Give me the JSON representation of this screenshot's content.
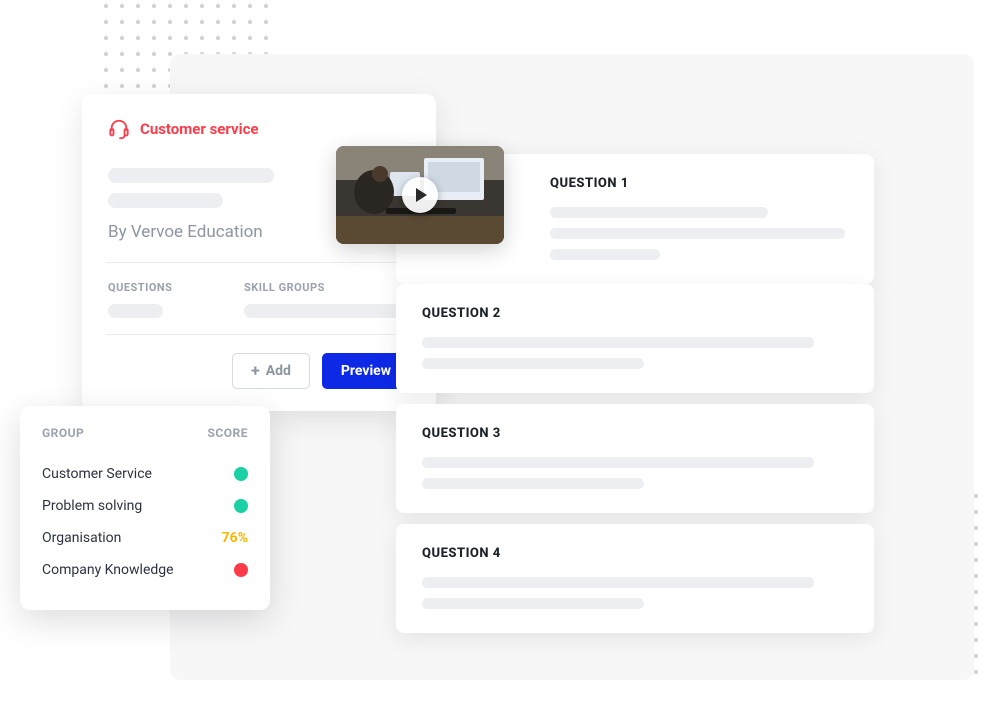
{
  "leftCard": {
    "title": "Customer service",
    "byline": "By Vervoe Education",
    "meta": {
      "questionsLabel": "QUESTIONS",
      "skillGroupsLabel": "SKILL GROUPS"
    },
    "actions": {
      "addLabel": "Add",
      "previewLabel": "Preview"
    }
  },
  "questions": {
    "q1": "QUESTION 1",
    "q2": "QUESTION 2",
    "q3": "QUESTION 3",
    "q4": "QUESTION 4"
  },
  "scoreCard": {
    "groupHeader": "GROUP",
    "scoreHeader": "SCORE",
    "rows": {
      "r1": {
        "name": "Customer Service"
      },
      "r2": {
        "name": "Problem solving"
      },
      "r3": {
        "name": "Organisation",
        "pct": "76%"
      },
      "r4": {
        "name": "Company Knowledge"
      }
    }
  }
}
